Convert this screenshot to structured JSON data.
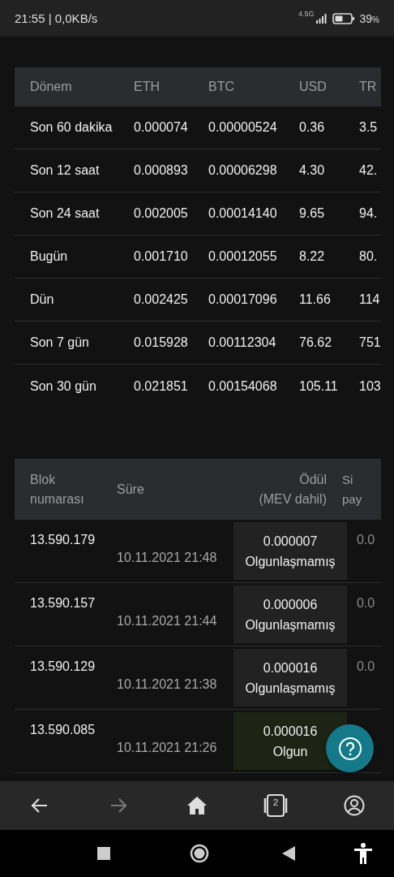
{
  "status_bar": {
    "time_speed": "21:55 | 0,0KB/s",
    "network": "4.5G",
    "battery_percent": "39",
    "battery_unit": "%"
  },
  "period_table": {
    "columns": [
      "Dönem",
      "ETH",
      "BTC",
      "USD",
      "TR"
    ],
    "rows": [
      [
        "Son 60 dakika",
        "0.000074",
        "0.00000524",
        "0.36",
        "3.5"
      ],
      [
        "Son 12 saat",
        "0.000893",
        "0.00006298",
        "4.30",
        "42."
      ],
      [
        "Son 24 saat",
        "0.002005",
        "0.00014140",
        "9.65",
        "94."
      ],
      [
        "Bugün",
        "0.001710",
        "0.00012055",
        "8.22",
        "80."
      ],
      [
        "Dün",
        "0.002425",
        "0.00017096",
        "11.66",
        "114"
      ],
      [
        "Son 7 gün",
        "0.015928",
        "0.00112304",
        "76.62",
        "751"
      ],
      [
        "Son 30 gün",
        "0.021851",
        "0.00154068",
        "105.11",
        "103"
      ]
    ]
  },
  "block_table": {
    "columns": [
      [
        "Blok",
        "numarası"
      ],
      [
        "Süre"
      ],
      [
        "Ödül",
        "(MEV dahil)"
      ],
      [
        "Si",
        "pay"
      ]
    ],
    "rows": [
      {
        "block": "13.590.179",
        "time": "10.11.2021 21:48",
        "reward": "0.000007",
        "status": "Olgunlaşmamış",
        "mature": false,
        "column_4": "0.0"
      },
      {
        "block": "13.590.157",
        "time": "10.11.2021 21:44",
        "reward": "0.000006",
        "status": "Olgunlaşmamış",
        "mature": false,
        "column_4": "0.0"
      },
      {
        "block": "13.590.129",
        "time": "10.11.2021 21:38",
        "reward": "0.000016",
        "status": "Olgunlaşmamış",
        "mature": false,
        "column_4": "0.0"
      },
      {
        "block": "13.590.085",
        "time": "10.11.2021 21:26",
        "reward": "0.000016",
        "status": "Olgun",
        "mature": true
      }
    ]
  },
  "bottom_nav": [
    {
      "kind": "back",
      "disabled": false
    },
    {
      "kind": "forward",
      "disabled": true
    },
    {
      "kind": "home",
      "disabled": false
    },
    {
      "kind": "tabs",
      "count": "2",
      "disabled": false
    },
    {
      "kind": "account",
      "disabled": false
    }
  ]
}
